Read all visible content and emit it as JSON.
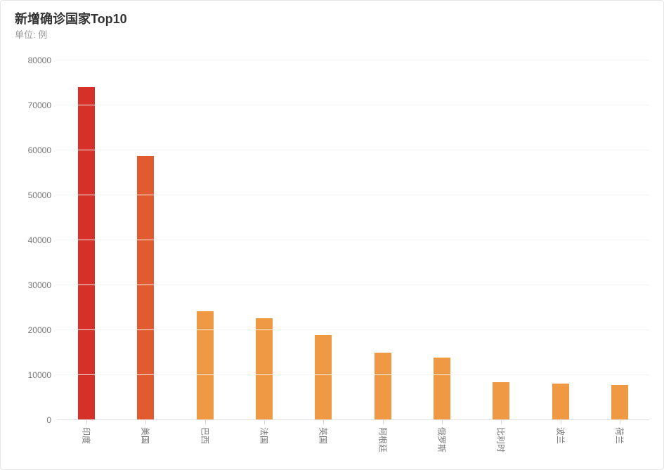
{
  "title": "新增确诊国家Top10",
  "subtitle": "单位: 例",
  "chart_data": {
    "type": "bar",
    "categories": [
      "印度",
      "美国",
      "巴西",
      "法国",
      "英国",
      "阿根廷",
      "俄罗斯",
      "比利时",
      "波兰",
      "荷兰"
    ],
    "values": [
      74000,
      58700,
      24200,
      22600,
      18900,
      15000,
      13900,
      8400,
      8200,
      7800
    ],
    "ylim": [
      0,
      80000
    ],
    "yticks": [
      0,
      10000,
      20000,
      30000,
      40000,
      50000,
      60000,
      70000,
      80000
    ],
    "bar_colors": [
      "#d53129",
      "#e25a2f",
      "#ef9945",
      "#ef9945",
      "#ef9945",
      "#ef9945",
      "#ef9945",
      "#ef9945",
      "#ef9945",
      "#ef9945"
    ],
    "title": "新增确诊国家Top10",
    "xlabel": "",
    "ylabel": ""
  }
}
